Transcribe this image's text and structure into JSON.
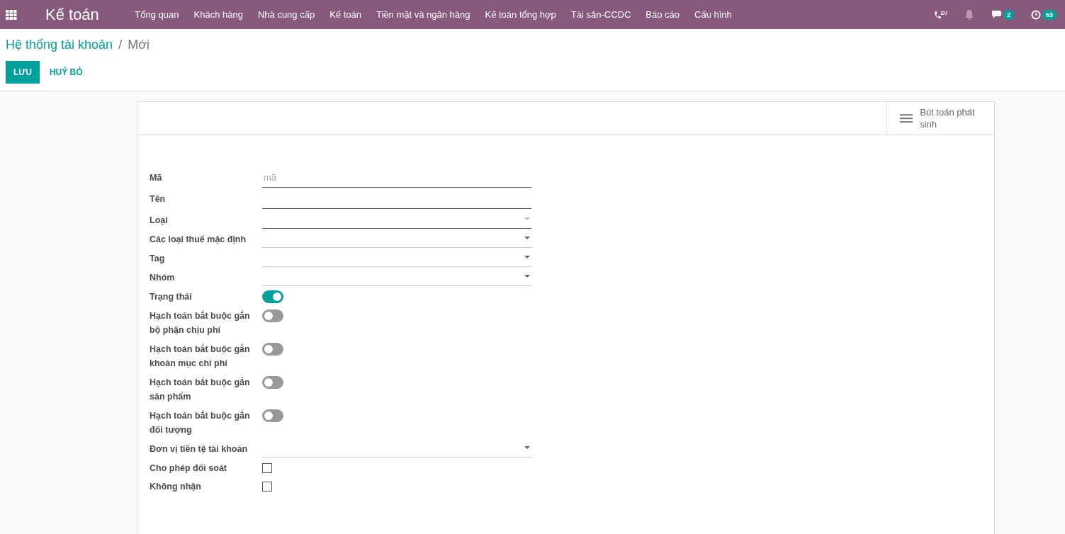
{
  "navbar": {
    "app_title": "Kế toán",
    "menu": [
      "Tổng quan",
      "Khách hàng",
      "Nhà cung cấp",
      "Kế toán",
      "Tiền mặt và ngân hàng",
      "Kế toán tổng hợp",
      "Tài sản-CCDC",
      "Báo cáo",
      "Cấu hình"
    ],
    "phone_badge": "EV",
    "messages_count": "2",
    "activities_count": "63"
  },
  "breadcrumb": {
    "parent": "Hệ thống tài khoản",
    "separator": "/",
    "current": "Mới"
  },
  "actions": {
    "save": "LƯU",
    "discard": "HUỶ BỎ"
  },
  "button_box": {
    "label": "Bút toán phát sinh"
  },
  "fields": [
    {
      "kind": "input",
      "label": "Mã",
      "placeholder": "mã",
      "required": true
    },
    {
      "kind": "input",
      "label": "Tên",
      "required": true
    },
    {
      "kind": "select",
      "label": "Loại",
      "required": true
    },
    {
      "kind": "select",
      "label": "Các loại thuế mặc định",
      "required": false
    },
    {
      "kind": "select",
      "label": "Tag",
      "required": false
    },
    {
      "kind": "select",
      "label": "Nhóm",
      "required": false
    },
    {
      "kind": "toggle",
      "label": "Trạng thái",
      "on": true
    },
    {
      "kind": "toggle",
      "label": "Hạch toán bắt buộc gắn bộ phận chịu phí",
      "on": false
    },
    {
      "kind": "toggle",
      "label": "Hạch toán bắt buộc gắn khoản mục chi phí",
      "on": false
    },
    {
      "kind": "toggle",
      "label": "Hạch toán bắt buộc gắn sản phẩm",
      "on": false
    },
    {
      "kind": "toggle",
      "label": "Hạch toán bắt buộc gắn đối tượng",
      "on": false
    },
    {
      "kind": "select",
      "label": "Đơn vị tiền tệ tài khoản",
      "required": false
    },
    {
      "kind": "checkbox",
      "label": "Cho phép đối soát",
      "checked": false
    },
    {
      "kind": "checkbox",
      "label": "Không nhận",
      "checked": false
    }
  ]
}
